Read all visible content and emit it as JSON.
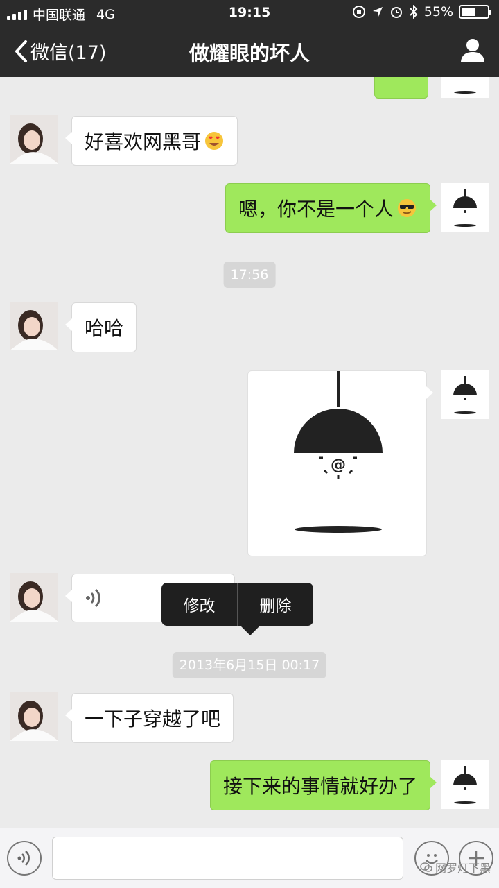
{
  "status_bar": {
    "carrier": "中国联通",
    "network": "4G",
    "time": "19:15",
    "battery_percent_text": "55%",
    "battery_level": 0.55
  },
  "nav": {
    "back_label": "微信(17)",
    "title": "做耀眼的坏人",
    "profile_icon": "person-icon"
  },
  "messages": [
    {
      "sender": "them",
      "text": "好喜欢网黑哥",
      "emoji": "heart-eyes-emoji"
    },
    {
      "sender": "me",
      "text": "嗯，你不是一个人",
      "emoji": "sunglasses-emoji"
    },
    {
      "timestamp": "17:56"
    },
    {
      "sender": "them",
      "text": "哈哈"
    },
    {
      "sender": "me",
      "image": "lamp-image"
    },
    {
      "sender": "them",
      "voice": true
    },
    {
      "timestamp": "2013年6月15日 00:17"
    },
    {
      "sender": "them",
      "text": "一下子穿越了吧"
    },
    {
      "sender": "me",
      "text": "接下来的事情就好办了"
    }
  ],
  "context_menu": {
    "edit": "修改",
    "delete": "删除"
  },
  "input_bar": {
    "voice_icon": "voice-icon",
    "emoji_icon": "emoji-icon",
    "plus_icon": "plus-icon",
    "input_value": "",
    "watermark": "网罗灯下黑"
  },
  "colors": {
    "bar_bg": "#2b2b2b",
    "chat_bg": "#ebebeb",
    "outgoing_bubble": "#9fe85c",
    "incoming_bubble": "#ffffff"
  }
}
